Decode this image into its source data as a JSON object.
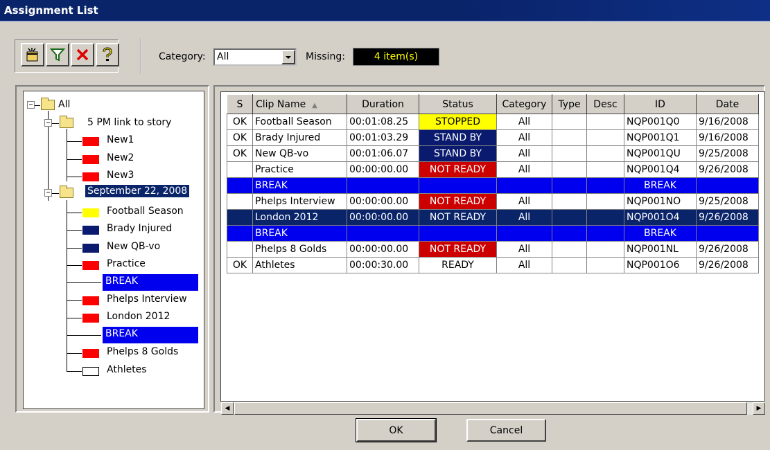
{
  "window": {
    "title": "Assignment List"
  },
  "toolbar": {
    "icons": [
      "new-item-icon",
      "filter-icon",
      "delete-icon",
      "help-icon"
    ],
    "category_label": "Category:",
    "category_value": "All",
    "missing_label": "Missing:",
    "missing_value": "4 item(s)"
  },
  "tree": {
    "root": "All",
    "group1": "5 PM link to story",
    "group1_items": [
      "New1",
      "New2",
      "New3"
    ],
    "group2": "September 22, 2008",
    "group2_items": [
      "Football Season",
      "Brady Injured",
      "New QB-vo",
      "Practice",
      "BREAK",
      "Phelps Interview",
      "London 2012",
      "BREAK",
      "Phelps 8 Golds",
      "Athletes"
    ]
  },
  "grid": {
    "columns": [
      "S",
      "Clip Name",
      "Duration",
      "Status",
      "Category",
      "Type",
      "Desc",
      "ID",
      "Date"
    ],
    "rows": [
      [
        "OK",
        "Football Season",
        "00:01:08.25",
        "STOPPED",
        "All",
        "",
        "",
        "NQP001Q0",
        "9/16/2008"
      ],
      [
        "OK",
        "Brady Injured",
        "00:01:03.29",
        "STAND BY",
        "All",
        "",
        "",
        "NQP001Q1",
        "9/16/2008"
      ],
      [
        "OK",
        "New QB-vo",
        "00:01:06.07",
        "STAND BY",
        "All",
        "",
        "",
        "NQP001QU",
        "9/25/2008"
      ],
      [
        "",
        "Practice",
        "00:00:00.00",
        "NOT READY",
        "All",
        "",
        "",
        "NQP001Q4",
        "9/26/2008"
      ],
      [
        "",
        "BREAK",
        "",
        "",
        "",
        "",
        "",
        "BREAK",
        ""
      ],
      [
        "",
        "Phelps Interview",
        "00:00:00.00",
        "NOT READY",
        "All",
        "",
        "",
        "NQP001NO",
        "9/25/2008"
      ],
      [
        "",
        "London 2012",
        "00:00:00.00",
        "NOT READY",
        "All",
        "",
        "",
        "NQP001O4",
        "9/26/2008"
      ],
      [
        "",
        "BREAK",
        "",
        "",
        "",
        "",
        "",
        "BREAK",
        ""
      ],
      [
        "",
        "Phelps 8 Golds",
        "00:00:00.00",
        "NOT READY",
        "All",
        "",
        "",
        "NQP001NL",
        "9/26/2008"
      ],
      [
        "OK",
        "Athletes",
        "00:00:30.00",
        "READY",
        "All",
        "",
        "",
        "NQP001O6",
        "9/26/2008"
      ]
    ]
  },
  "buttons": {
    "ok": "OK",
    "cancel": "Cancel"
  },
  "colors": {
    "title_bar": "#0a246a",
    "stopped": "#ffff00",
    "standby": "#0a1a6e",
    "not_ready": "#cc0000",
    "break_row": "#0000ee"
  }
}
